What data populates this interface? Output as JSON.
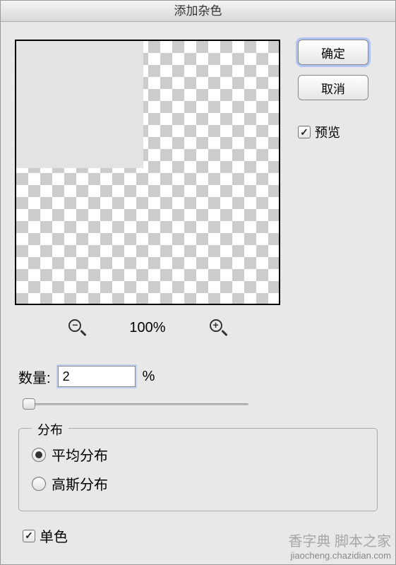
{
  "dialog": {
    "title": "添加杂色"
  },
  "buttons": {
    "ok": "确定",
    "cancel": "取消",
    "preview_label": "预览",
    "preview_checked": true
  },
  "zoom": {
    "level": "100%"
  },
  "amount": {
    "label": "数量:",
    "value": "2",
    "unit": "%"
  },
  "distribution": {
    "group_label": "分布",
    "options": [
      {
        "label": "平均分布",
        "selected": true
      },
      {
        "label": "高斯分布",
        "selected": false
      }
    ]
  },
  "monochrome": {
    "label": "单色",
    "checked": true
  },
  "footer": {
    "site_main": "香字典 脚本之家",
    "site_sub": "jiaocheng.chazidian.com"
  }
}
